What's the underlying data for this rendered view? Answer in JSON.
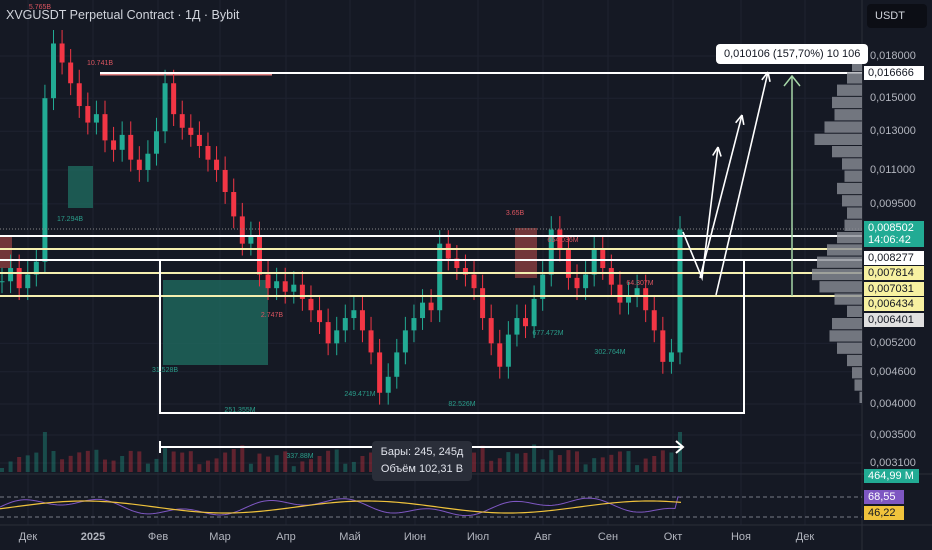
{
  "header": {
    "title": "XVGUSDT Perpetual Contract · 1Д · Bybit",
    "currency": "USDT"
  },
  "price_axis": {
    "labels": [
      "0,018000",
      "0,015000",
      "0,013000",
      "0,011000",
      "0,009500",
      "0,005200",
      "0,004600",
      "0,004000",
      "0,003500",
      "0,003100"
    ],
    "tags": [
      {
        "text": "0,016666",
        "style": "white"
      },
      {
        "text": "0,008502",
        "sub": "14:06:42",
        "style": "green"
      },
      {
        "text": "0,008277",
        "style": "white"
      },
      {
        "text": "0,007814",
        "style": "yellow"
      },
      {
        "text": "0,007031",
        "style": "yellow"
      },
      {
        "text": "0,006434",
        "style": "yellow"
      },
      {
        "text": "0,006401",
        "style": "grey"
      }
    ],
    "volume_tag": "464,99 M",
    "rsi_tags": [
      "68,55",
      "46,22"
    ]
  },
  "time_axis": [
    "Дек",
    "2025",
    "Фев",
    "Мар",
    "Апр",
    "Май",
    "Июн",
    "Июл",
    "Авг",
    "Сен",
    "Окт",
    "Ноя",
    "Дек"
  ],
  "measure_label": "0,010106 (157,70%) 10 106",
  "range_tooltip": {
    "bars": "Бары: 245, 245д",
    "volume": "Объём 102,31 B"
  },
  "volume_labels": [
    {
      "text": "5.765B",
      "color": "red"
    },
    {
      "text": "10.741B",
      "color": "red"
    },
    {
      "text": "17.294B",
      "color": "teal"
    },
    {
      "text": "31.528B",
      "color": "teal"
    },
    {
      "text": "2.747B",
      "color": "red"
    },
    {
      "text": "251.355M",
      "color": "teal"
    },
    {
      "text": "337.88M",
      "color": "teal"
    },
    {
      "text": "249.471M",
      "color": "teal"
    },
    {
      "text": "82.526M",
      "color": "teal"
    },
    {
      "text": "3.65B",
      "color": "red"
    },
    {
      "text": "654.036M",
      "color": "red"
    },
    {
      "text": "64.307M",
      "color": "red"
    },
    {
      "text": "677.472M",
      "color": "teal"
    },
    {
      "text": "302.764M",
      "color": "teal"
    }
  ],
  "colors": {
    "up": "#22ab94",
    "down": "#f23645",
    "bg": "#151924",
    "rsi": "#7e57c2",
    "rsi_ma": "#f0c33c",
    "level_yellow": "#f5f0b0"
  },
  "chart_data": {
    "type": "candlestick",
    "title": "XVGUSDT Perpetual Contract · 1Д · Bybit",
    "scale": "log",
    "ylim": [
      0.003,
      0.0195
    ],
    "closes": [
      0.0068,
      0.0072,
      0.0066,
      0.007,
      0.0074,
      0.015,
      0.019,
      0.0175,
      0.016,
      0.0145,
      0.0135,
      0.014,
      0.0125,
      0.012,
      0.0128,
      0.0115,
      0.011,
      0.0118,
      0.013,
      0.016,
      0.014,
      0.0132,
      0.0128,
      0.0122,
      0.0115,
      0.011,
      0.01,
      0.009,
      0.008,
      0.0083,
      0.007,
      0.0066,
      0.0068,
      0.0065,
      0.0067,
      0.0063,
      0.006,
      0.0057,
      0.0052,
      0.0055,
      0.0058,
      0.006,
      0.0055,
      0.005,
      0.0042,
      0.0045,
      0.005,
      0.0055,
      0.0058,
      0.0062,
      0.006,
      0.008,
      0.0075,
      0.0072,
      0.007,
      0.0066,
      0.0058,
      0.0052,
      0.0047,
      0.0054,
      0.0058,
      0.0056,
      0.0063,
      0.007,
      0.0085,
      0.0078,
      0.0069,
      0.0066,
      0.007,
      0.0078,
      0.0072,
      0.0067,
      0.0062,
      0.0064,
      0.0066,
      0.006,
      0.0055,
      0.0048,
      0.005,
      0.0085
    ],
    "price_levels": [
      0.016666,
      0.008277,
      0.007814,
      0.007031,
      0.006434
    ],
    "current_price": 0.008502,
    "volume_profile": [
      0.2,
      0.3,
      0.5,
      0.6,
      0.55,
      0.75,
      0.95,
      0.6,
      0.4,
      0.35,
      0.5,
      0.4,
      0.3,
      0.35,
      0.5,
      0.7,
      0.9,
      1.0,
      0.85,
      0.55,
      0.3,
      0.6,
      0.65,
      0.5,
      0.3,
      0.2,
      0.15,
      0.05
    ]
  }
}
